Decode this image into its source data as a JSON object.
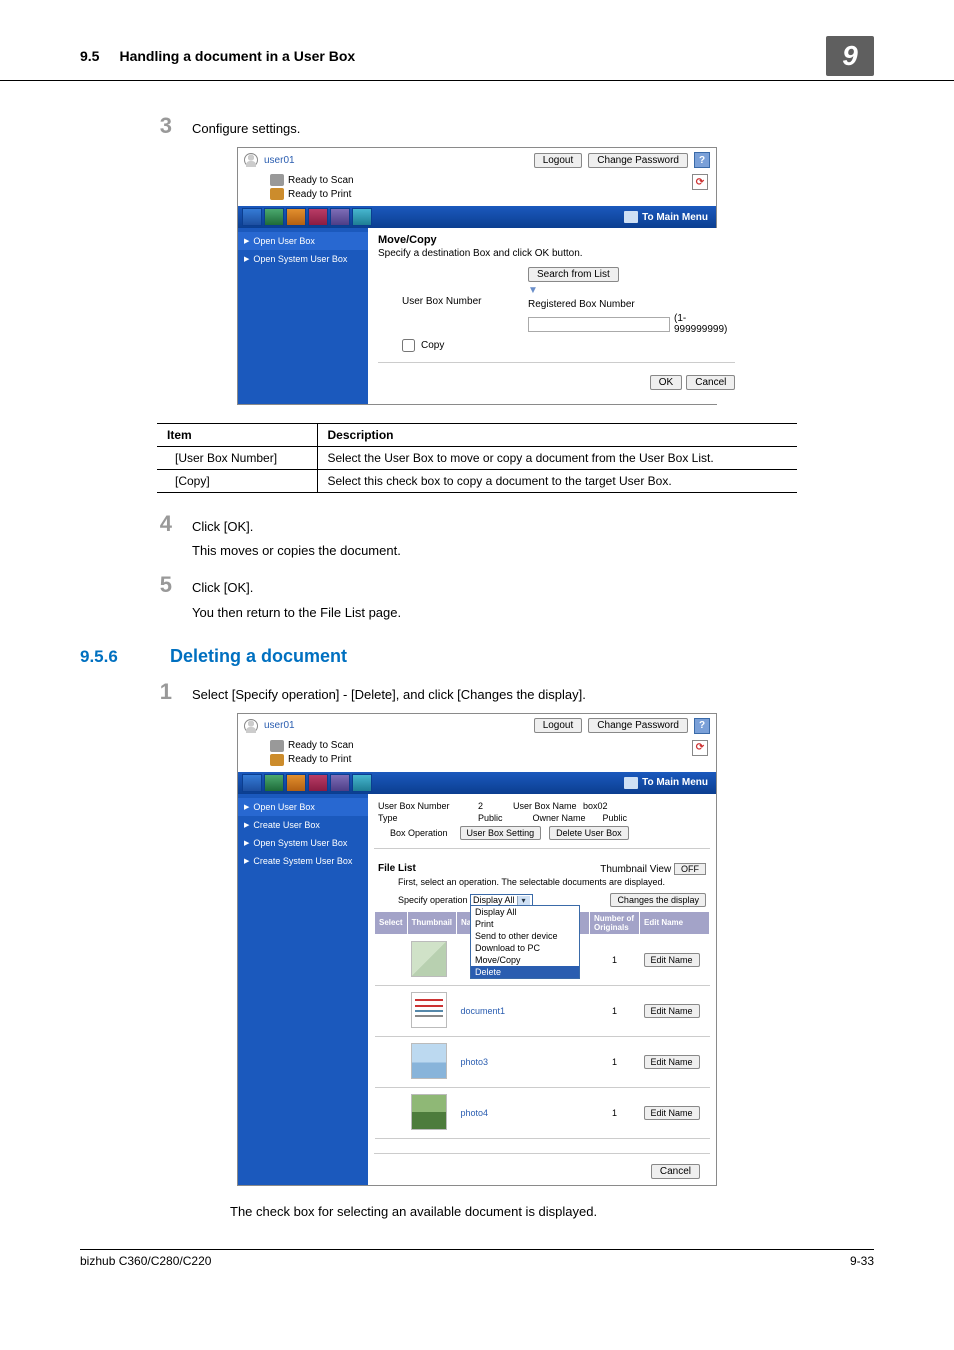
{
  "header": {
    "section_no": "9.5",
    "section_title": "Handling a document in a User Box",
    "chapter": "9"
  },
  "step3": {
    "num": "3",
    "text": "Configure settings.",
    "shot": {
      "user": "user01",
      "logout": "Logout",
      "change_pw": "Change Password",
      "ready_scan": "Ready to Scan",
      "ready_print": "Ready to Print",
      "to_main": "To Main Menu",
      "nav_open_user": "Open User Box",
      "nav_open_system": "Open System User Box",
      "title": "Move/Copy",
      "desc": "Specify a destination Box and click OK button.",
      "ubn_label": "User Box Number",
      "search_list": "Search from List",
      "reg_label": "Registered Box Number",
      "range": "(1-999999999)",
      "copy_label": "Copy",
      "ok": "OK",
      "cancel": "Cancel"
    }
  },
  "table": {
    "h_item": "Item",
    "h_desc": "Description",
    "rows": [
      {
        "item": "[User Box Number]",
        "desc": "Select the User Box to move or copy a document from the User Box List."
      },
      {
        "item": "[Copy]",
        "desc": "Select this check box to copy a document to the target User Box."
      }
    ]
  },
  "step4": {
    "num": "4",
    "text": "Click [OK].",
    "sub": "This moves or copies the document."
  },
  "step5": {
    "num": "5",
    "text": "Click [OK].",
    "sub": "You then return to the File List page."
  },
  "section": {
    "num": "9.5.6",
    "title": "Deleting a document"
  },
  "step1": {
    "num": "1",
    "text": "Select [Specify operation] - [Delete], and click [Changes the display].",
    "shot": {
      "user": "user01",
      "logout": "Logout",
      "change_pw": "Change Password",
      "ready_scan": "Ready to Scan",
      "ready_print": "Ready to Print",
      "to_main": "To Main Menu",
      "nav": [
        "Open User Box",
        "Create User Box",
        "Open System User Box",
        "Create System User Box"
      ],
      "ubn_k": "User Box Number",
      "ubn_v": "2",
      "ubname_k": "User Box Name",
      "ubname_v": "box02",
      "type_k": "Type",
      "type_v": "Public",
      "owner_k": "Owner Name",
      "owner_v": "Public",
      "box_op": "Box Operation",
      "ubs_btn": "User Box Setting",
      "del_btn": "Delete User Box",
      "file_list": "File List",
      "thumb_view": "Thumbnail View",
      "off": "OFF",
      "note": "First, select an operation. The selectable documents are displayed.",
      "spec_op": "Specify operation",
      "spec_val": "Display All",
      "changes": "Changes the display",
      "options": [
        "Display All",
        "Print",
        "Send to other device",
        "Download to PC",
        "Move/Copy",
        "Delete"
      ],
      "th": {
        "sel": "Select",
        "thumb": "Thumbnail",
        "name": "Name",
        "num": "Number of Originals",
        "edit": "Edit Name"
      },
      "rows": [
        {
          "name": "",
          "num": "1"
        },
        {
          "name": "document1",
          "num": "1"
        },
        {
          "name": "photo3",
          "num": "1"
        },
        {
          "name": "photo4",
          "num": "1"
        }
      ],
      "edit_btn": "Edit Name",
      "cancel": "Cancel"
    }
  },
  "tail_line": "The check box for selecting an available document is displayed.",
  "footer": {
    "left": "bizhub C360/C280/C220",
    "right": "9-33"
  }
}
